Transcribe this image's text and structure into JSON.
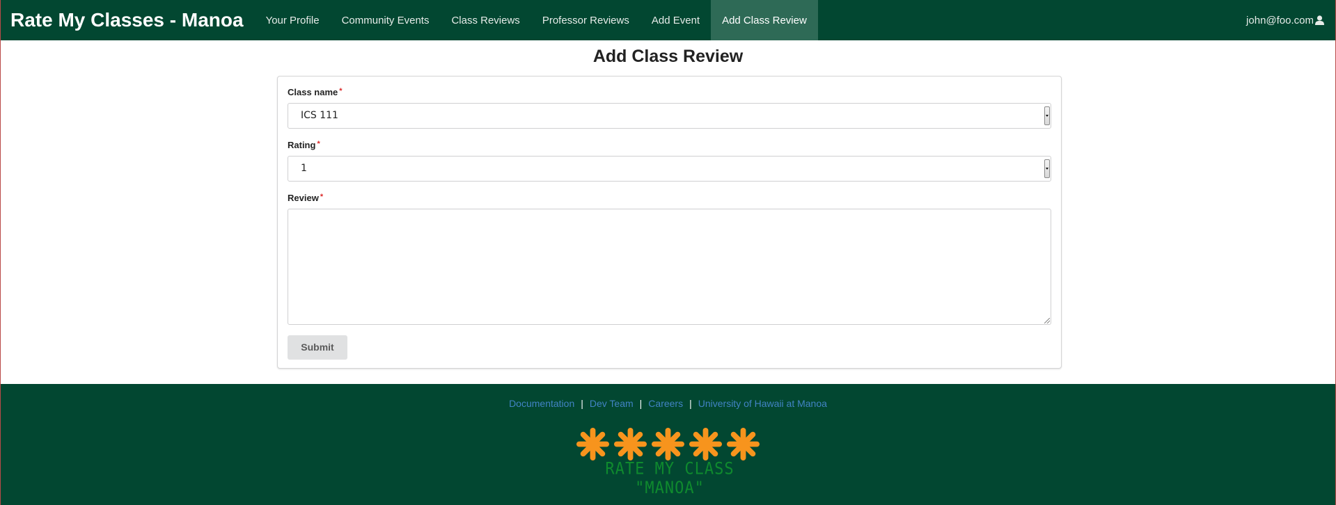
{
  "navbar": {
    "brand": "Rate My Classes - Manoa",
    "items": [
      {
        "label": "Your Profile",
        "active": false
      },
      {
        "label": "Community Events",
        "active": false
      },
      {
        "label": "Class Reviews",
        "active": false
      },
      {
        "label": "Professor Reviews",
        "active": false
      },
      {
        "label": "Add Event",
        "active": false
      },
      {
        "label": "Add Class Review",
        "active": true
      }
    ],
    "user": "john@foo.com",
    "user_icon": "user-icon"
  },
  "page": {
    "title": "Add Class Review"
  },
  "form": {
    "class_name": {
      "label": "Class name",
      "required_mark": "*",
      "value": "ICS 111"
    },
    "rating": {
      "label": "Rating",
      "required_mark": "*",
      "value": "1"
    },
    "review": {
      "label": "Review",
      "required_mark": "*",
      "value": ""
    },
    "submit_label": "Submit"
  },
  "footer": {
    "links": [
      "Documentation",
      "Dev Team",
      "Careers",
      "University of Hawaii at Manoa"
    ],
    "separator": "|",
    "logo_text": "RATE MY CLASS \"MANOA\"",
    "logo_icon": "asterisk-icon"
  },
  "colors": {
    "navbar_bg": "#024731",
    "active_tab_bg": "#2e6a56",
    "link": "#4183c4",
    "required": "#db2828",
    "logo_asterisk": "#f7941d",
    "logo_text": "#0f8a2e"
  }
}
